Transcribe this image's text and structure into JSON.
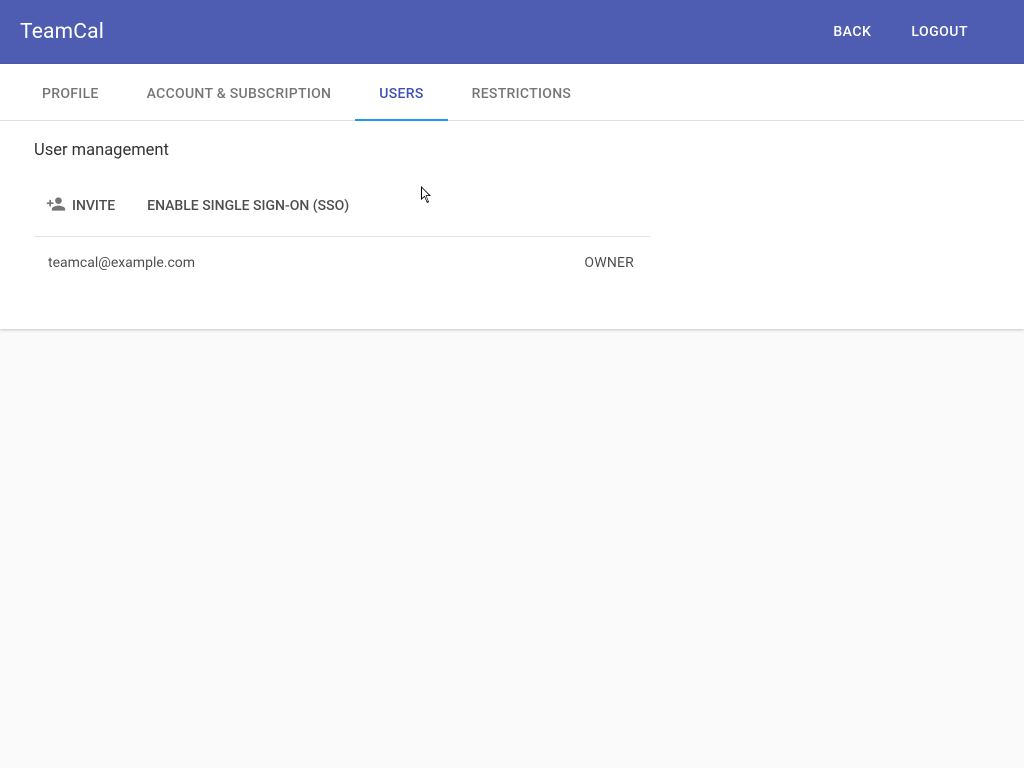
{
  "header": {
    "app_name": "TeamCal",
    "back_label": "BACK",
    "logout_label": "LOGOUT"
  },
  "tabs": [
    {
      "label": "PROFILE",
      "active": false
    },
    {
      "label": "ACCOUNT & SUBSCRIPTION",
      "active": false
    },
    {
      "label": "USERS",
      "active": true
    },
    {
      "label": "RESTRICTIONS",
      "active": false
    }
  ],
  "page": {
    "title": "User management",
    "invite_label": "INVITE",
    "sso_label": "ENABLE SINGLE SIGN-ON (SSO)"
  },
  "users": [
    {
      "email": "teamcal@example.com",
      "role": "OWNER"
    }
  ]
}
